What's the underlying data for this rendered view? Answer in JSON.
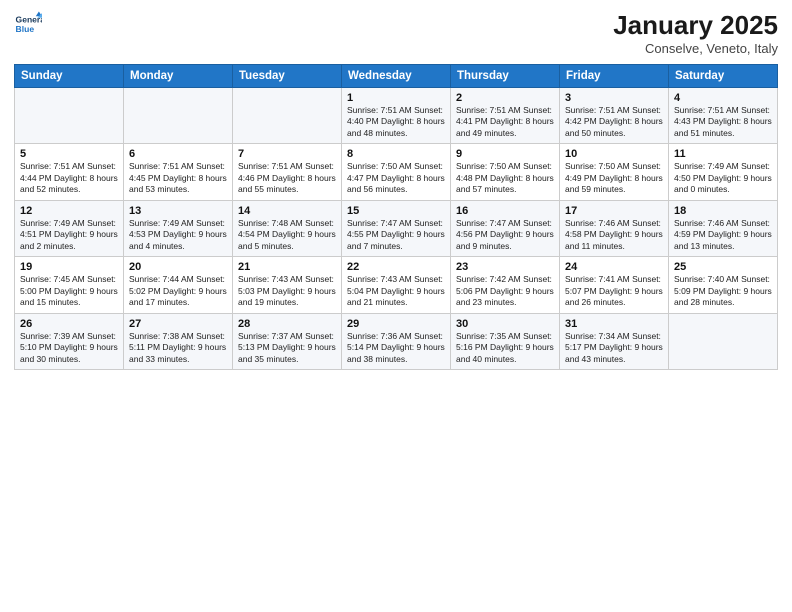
{
  "logo": {
    "line1": "General",
    "line2": "Blue"
  },
  "title": "January 2025",
  "subtitle": "Conselve, Veneto, Italy",
  "days_header": [
    "Sunday",
    "Monday",
    "Tuesday",
    "Wednesday",
    "Thursday",
    "Friday",
    "Saturday"
  ],
  "weeks": [
    [
      {
        "num": "",
        "info": ""
      },
      {
        "num": "",
        "info": ""
      },
      {
        "num": "",
        "info": ""
      },
      {
        "num": "1",
        "info": "Sunrise: 7:51 AM\nSunset: 4:40 PM\nDaylight: 8 hours\nand 48 minutes."
      },
      {
        "num": "2",
        "info": "Sunrise: 7:51 AM\nSunset: 4:41 PM\nDaylight: 8 hours\nand 49 minutes."
      },
      {
        "num": "3",
        "info": "Sunrise: 7:51 AM\nSunset: 4:42 PM\nDaylight: 8 hours\nand 50 minutes."
      },
      {
        "num": "4",
        "info": "Sunrise: 7:51 AM\nSunset: 4:43 PM\nDaylight: 8 hours\nand 51 minutes."
      }
    ],
    [
      {
        "num": "5",
        "info": "Sunrise: 7:51 AM\nSunset: 4:44 PM\nDaylight: 8 hours\nand 52 minutes."
      },
      {
        "num": "6",
        "info": "Sunrise: 7:51 AM\nSunset: 4:45 PM\nDaylight: 8 hours\nand 53 minutes."
      },
      {
        "num": "7",
        "info": "Sunrise: 7:51 AM\nSunset: 4:46 PM\nDaylight: 8 hours\nand 55 minutes."
      },
      {
        "num": "8",
        "info": "Sunrise: 7:50 AM\nSunset: 4:47 PM\nDaylight: 8 hours\nand 56 minutes."
      },
      {
        "num": "9",
        "info": "Sunrise: 7:50 AM\nSunset: 4:48 PM\nDaylight: 8 hours\nand 57 minutes."
      },
      {
        "num": "10",
        "info": "Sunrise: 7:50 AM\nSunset: 4:49 PM\nDaylight: 8 hours\nand 59 minutes."
      },
      {
        "num": "11",
        "info": "Sunrise: 7:49 AM\nSunset: 4:50 PM\nDaylight: 9 hours\nand 0 minutes."
      }
    ],
    [
      {
        "num": "12",
        "info": "Sunrise: 7:49 AM\nSunset: 4:51 PM\nDaylight: 9 hours\nand 2 minutes."
      },
      {
        "num": "13",
        "info": "Sunrise: 7:49 AM\nSunset: 4:53 PM\nDaylight: 9 hours\nand 4 minutes."
      },
      {
        "num": "14",
        "info": "Sunrise: 7:48 AM\nSunset: 4:54 PM\nDaylight: 9 hours\nand 5 minutes."
      },
      {
        "num": "15",
        "info": "Sunrise: 7:47 AM\nSunset: 4:55 PM\nDaylight: 9 hours\nand 7 minutes."
      },
      {
        "num": "16",
        "info": "Sunrise: 7:47 AM\nSunset: 4:56 PM\nDaylight: 9 hours\nand 9 minutes."
      },
      {
        "num": "17",
        "info": "Sunrise: 7:46 AM\nSunset: 4:58 PM\nDaylight: 9 hours\nand 11 minutes."
      },
      {
        "num": "18",
        "info": "Sunrise: 7:46 AM\nSunset: 4:59 PM\nDaylight: 9 hours\nand 13 minutes."
      }
    ],
    [
      {
        "num": "19",
        "info": "Sunrise: 7:45 AM\nSunset: 5:00 PM\nDaylight: 9 hours\nand 15 minutes."
      },
      {
        "num": "20",
        "info": "Sunrise: 7:44 AM\nSunset: 5:02 PM\nDaylight: 9 hours\nand 17 minutes."
      },
      {
        "num": "21",
        "info": "Sunrise: 7:43 AM\nSunset: 5:03 PM\nDaylight: 9 hours\nand 19 minutes."
      },
      {
        "num": "22",
        "info": "Sunrise: 7:43 AM\nSunset: 5:04 PM\nDaylight: 9 hours\nand 21 minutes."
      },
      {
        "num": "23",
        "info": "Sunrise: 7:42 AM\nSunset: 5:06 PM\nDaylight: 9 hours\nand 23 minutes."
      },
      {
        "num": "24",
        "info": "Sunrise: 7:41 AM\nSunset: 5:07 PM\nDaylight: 9 hours\nand 26 minutes."
      },
      {
        "num": "25",
        "info": "Sunrise: 7:40 AM\nSunset: 5:09 PM\nDaylight: 9 hours\nand 28 minutes."
      }
    ],
    [
      {
        "num": "26",
        "info": "Sunrise: 7:39 AM\nSunset: 5:10 PM\nDaylight: 9 hours\nand 30 minutes."
      },
      {
        "num": "27",
        "info": "Sunrise: 7:38 AM\nSunset: 5:11 PM\nDaylight: 9 hours\nand 33 minutes."
      },
      {
        "num": "28",
        "info": "Sunrise: 7:37 AM\nSunset: 5:13 PM\nDaylight: 9 hours\nand 35 minutes."
      },
      {
        "num": "29",
        "info": "Sunrise: 7:36 AM\nSunset: 5:14 PM\nDaylight: 9 hours\nand 38 minutes."
      },
      {
        "num": "30",
        "info": "Sunrise: 7:35 AM\nSunset: 5:16 PM\nDaylight: 9 hours\nand 40 minutes."
      },
      {
        "num": "31",
        "info": "Sunrise: 7:34 AM\nSunset: 5:17 PM\nDaylight: 9 hours\nand 43 minutes."
      },
      {
        "num": "",
        "info": ""
      }
    ]
  ]
}
